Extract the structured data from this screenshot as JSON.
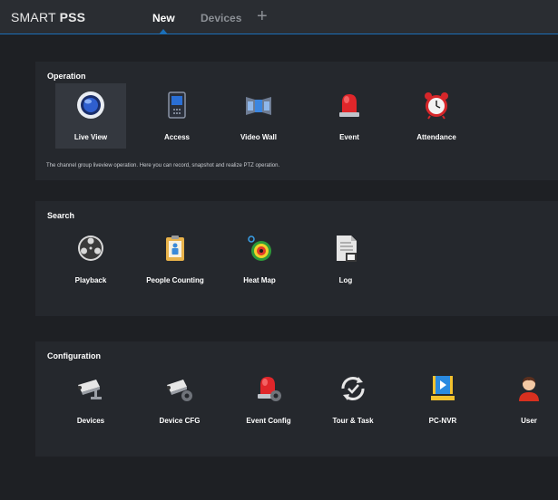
{
  "app": {
    "brand_light": "SMART",
    "brand_bold": "PSS"
  },
  "tabs": {
    "new_label": "New",
    "devices_label": "Devices",
    "add_label": "+"
  },
  "colors": {
    "accent": "#1b6fb8",
    "background": "#1e2024",
    "panel": "#25282d"
  },
  "operation": {
    "title": "Operation",
    "description": "The channel group liveview operation. Here you can record, snapshot and realize PTZ operation.",
    "items": [
      {
        "label": "Live View",
        "icon": "live-view-icon"
      },
      {
        "label": "Access",
        "icon": "access-icon"
      },
      {
        "label": "Video Wall",
        "icon": "video-wall-icon"
      },
      {
        "label": "Event",
        "icon": "event-icon"
      },
      {
        "label": "Attendance",
        "icon": "attendance-icon"
      }
    ]
  },
  "search": {
    "title": "Search",
    "items": [
      {
        "label": "Playback",
        "icon": "playback-icon"
      },
      {
        "label": "People Counting",
        "icon": "people-counting-icon"
      },
      {
        "label": "Heat Map",
        "icon": "heat-map-icon"
      },
      {
        "label": "Log",
        "icon": "log-icon"
      }
    ]
  },
  "configuration": {
    "title": "Configuration",
    "items": [
      {
        "label": "Devices",
        "icon": "devices-camera-icon"
      },
      {
        "label": "Device CFG",
        "icon": "device-cfg-icon"
      },
      {
        "label": "Event Config",
        "icon": "event-config-icon"
      },
      {
        "label": "Tour & Task",
        "icon": "tour-task-icon"
      },
      {
        "label": "PC-NVR",
        "icon": "pc-nvr-icon"
      },
      {
        "label": "User",
        "icon": "user-icon"
      }
    ]
  }
}
